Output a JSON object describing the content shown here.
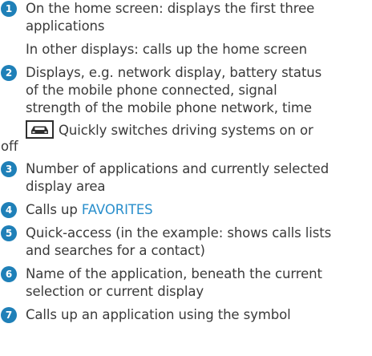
{
  "items": [
    {
      "number": "1",
      "lines": [
        "On the home screen: displays the first three",
        "applications",
        "In other displays: calls up the home screen"
      ]
    },
    {
      "number": "2",
      "lines": [
        "Displays, e.g. network display, battery status",
        "of the mobile phone connected, signal",
        "strength of the mobile phone network, time"
      ],
      "icon_name": "car-icon",
      "icon_line": "Quickly switches driving systems on or",
      "icon_line_cont": "off"
    },
    {
      "number": "3",
      "lines": [
        "Number of applications and currently selected",
        "display area"
      ]
    },
    {
      "number": "4",
      "prefix": "Calls up ",
      "link": "FAVORITES"
    },
    {
      "number": "5",
      "lines": [
        "Quick-access (in the example: shows calls lists",
        "and searches for a contact)"
      ]
    },
    {
      "number": "6",
      "lines": [
        "Name of the application, beneath the current",
        "selection or current display"
      ]
    },
    {
      "number": "7",
      "lines": [
        "Calls up an application using the symbol"
      ]
    }
  ],
  "colors": {
    "badge": "#1f80b8",
    "link": "#2a8fcc",
    "text": "#3a3a3a"
  }
}
